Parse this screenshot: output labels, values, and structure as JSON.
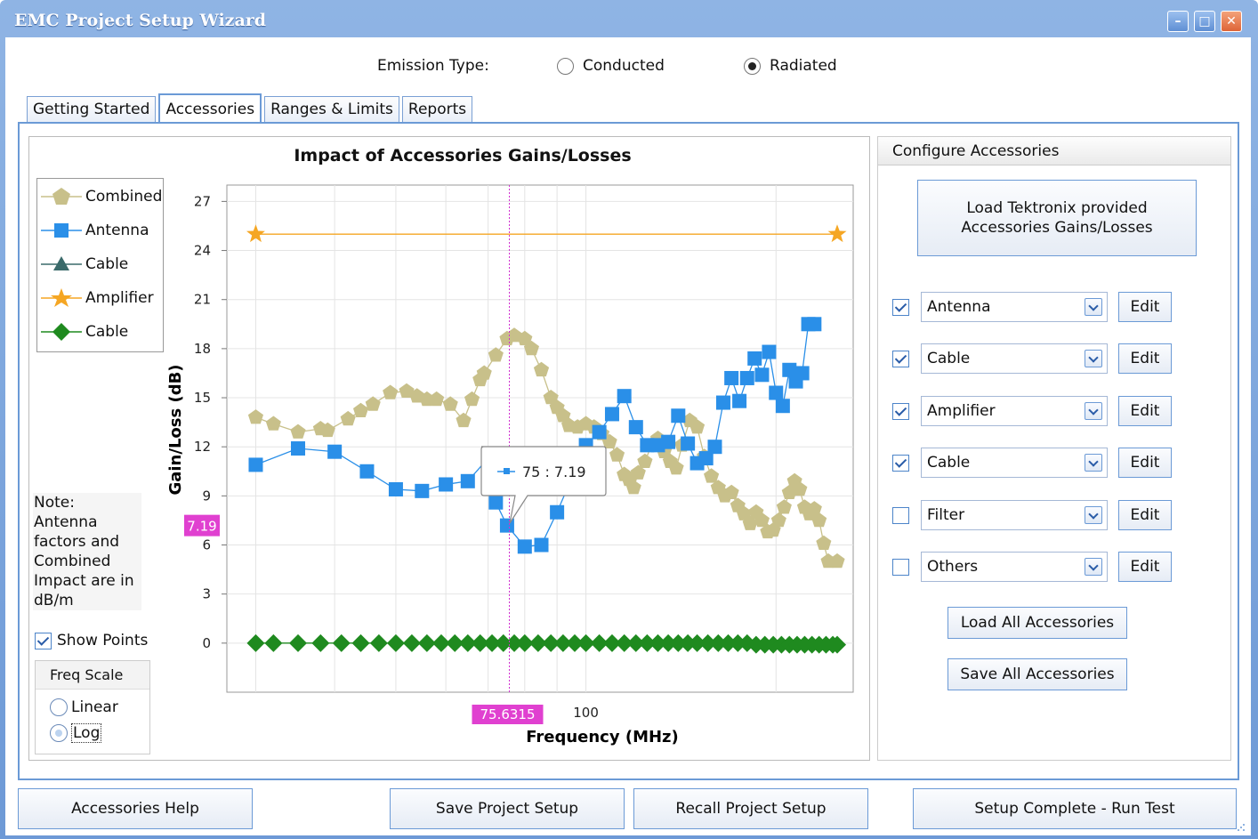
{
  "window": {
    "title": "EMC Project Setup Wizard",
    "controls": [
      "minimize",
      "maximize",
      "close"
    ]
  },
  "emission": {
    "label": "Emission Type:",
    "options": [
      {
        "label": "Conducted",
        "selected": false
      },
      {
        "label": "Radiated",
        "selected": true
      }
    ]
  },
  "tabs": [
    {
      "label": "Getting Started",
      "active": false
    },
    {
      "label": "Accessories",
      "active": true
    },
    {
      "label": "Ranges & Limits",
      "active": false
    },
    {
      "label": "Reports",
      "active": false
    }
  ],
  "chart_data": {
    "type": "line",
    "title": "Impact of Accessories Gains/Losses",
    "xlabel": "Frequency (MHz)",
    "ylabel": "Gain/Loss (dB)",
    "xscale": "log",
    "x_tick_labels": [
      "100"
    ],
    "ylim": [
      -3,
      28
    ],
    "y_ticks": [
      0,
      3,
      6,
      9,
      12,
      15,
      18,
      21,
      24,
      27
    ],
    "grid": true,
    "legend_position": "top-left",
    "series": [
      {
        "name": "Combined",
        "color": "#c8c08a",
        "marker": "pentagon",
        "values": [
          [
            30,
            13.8
          ],
          [
            32,
            13.4
          ],
          [
            35,
            12.9
          ],
          [
            38,
            13.1
          ],
          [
            39,
            13.0
          ],
          [
            42,
            13.7
          ],
          [
            44,
            14.2
          ],
          [
            46,
            14.6
          ],
          [
            49,
            15.3
          ],
          [
            52,
            15.4
          ],
          [
            54,
            15.1
          ],
          [
            56,
            14.9
          ],
          [
            58,
            14.9
          ],
          [
            61,
            14.6
          ],
          [
            64,
            13.6
          ],
          [
            66,
            14.9
          ],
          [
            68,
            16.1
          ],
          [
            69,
            16.5
          ],
          [
            72,
            17.6
          ],
          [
            75,
            18.6
          ],
          [
            77,
            18.8
          ],
          [
            80,
            18.6
          ],
          [
            82,
            18.0
          ],
          [
            85,
            16.7
          ],
          [
            88,
            15.0
          ],
          [
            90,
            14.4
          ],
          [
            92,
            13.9
          ],
          [
            94,
            13.3
          ],
          [
            97,
            13.2
          ],
          [
            100,
            13.4
          ],
          [
            103,
            13.2
          ],
          [
            106,
            12.8
          ],
          [
            109,
            12.3
          ],
          [
            112,
            11.5
          ],
          [
            115,
            10.3
          ],
          [
            117,
            10.0
          ],
          [
            119,
            9.5
          ],
          [
            121,
            10.4
          ],
          [
            124,
            11.1
          ],
          [
            127,
            12.1
          ],
          [
            130,
            12.5
          ],
          [
            133,
            11.7
          ],
          [
            136,
            11.1
          ],
          [
            139,
            10.7
          ],
          [
            142,
            12.1
          ],
          [
            146,
            13.6
          ],
          [
            150,
            13.2
          ],
          [
            154,
            11.4
          ],
          [
            158,
            10.2
          ],
          [
            162,
            9.5
          ],
          [
            166,
            9.0
          ],
          [
            170,
            9.2
          ],
          [
            174,
            8.4
          ],
          [
            178,
            7.9
          ],
          [
            182,
            7.3
          ],
          [
            186,
            8.0
          ],
          [
            190,
            7.5
          ],
          [
            194,
            6.8
          ],
          [
            198,
            6.9
          ],
          [
            202,
            7.5
          ],
          [
            206,
            8.3
          ],
          [
            210,
            9.2
          ],
          [
            214,
            9.9
          ],
          [
            218,
            9.4
          ],
          [
            222,
            8.3
          ],
          [
            226,
            7.9
          ],
          [
            230,
            8.2
          ],
          [
            234,
            7.5
          ],
          [
            238,
            6.1
          ],
          [
            242,
            5.0
          ],
          [
            250,
            5.0
          ]
        ]
      },
      {
        "name": "Antenna",
        "color": "#2a8fe8",
        "marker": "square",
        "values": [
          [
            30,
            10.9
          ],
          [
            35,
            11.9
          ],
          [
            40,
            11.7
          ],
          [
            45,
            10.5
          ],
          [
            50,
            9.4
          ],
          [
            55,
            9.3
          ],
          [
            60,
            9.7
          ],
          [
            65,
            9.9
          ],
          [
            70,
            11.3
          ],
          [
            72,
            8.6
          ],
          [
            75,
            7.19
          ],
          [
            80,
            5.9
          ],
          [
            85,
            6.0
          ],
          [
            90,
            8.0
          ],
          [
            100,
            12.1
          ],
          [
            105,
            12.9
          ],
          [
            110,
            14.0
          ],
          [
            115,
            15.1
          ],
          [
            120,
            13.2
          ],
          [
            125,
            12.1
          ],
          [
            130,
            12.1
          ],
          [
            135,
            12.3
          ],
          [
            140,
            13.9
          ],
          [
            145,
            12.2
          ],
          [
            150,
            11.0
          ],
          [
            155,
            11.3
          ],
          [
            160,
            12.0
          ],
          [
            165,
            14.7
          ],
          [
            170,
            16.2
          ],
          [
            175,
            14.8
          ],
          [
            180,
            16.2
          ],
          [
            185,
            17.4
          ],
          [
            190,
            16.4
          ],
          [
            195,
            17.8
          ],
          [
            200,
            15.3
          ],
          [
            205,
            14.5
          ],
          [
            210,
            16.7
          ],
          [
            215,
            16.0
          ],
          [
            220,
            16.5
          ],
          [
            225,
            19.5
          ],
          [
            230,
            19.5
          ]
        ]
      },
      {
        "name": "Cable",
        "color": "#3a6a6a",
        "marker": "triangle",
        "values": []
      },
      {
        "name": "Amplifier",
        "color": "#f5a623",
        "marker": "star",
        "values": [
          [
            30,
            25
          ],
          [
            250,
            25
          ]
        ]
      },
      {
        "name": "Cable",
        "color": "#1f8a1f",
        "marker": "diamond",
        "values": [
          [
            30,
            0
          ],
          [
            32,
            0
          ],
          [
            35,
            0
          ],
          [
            38,
            0
          ],
          [
            41,
            0
          ],
          [
            44,
            0
          ],
          [
            47,
            0
          ],
          [
            50,
            0
          ],
          [
            53,
            0
          ],
          [
            56,
            0
          ],
          [
            59,
            0
          ],
          [
            62,
            0
          ],
          [
            65,
            0
          ],
          [
            68,
            0
          ],
          [
            71,
            0
          ],
          [
            74,
            0
          ],
          [
            77,
            0
          ],
          [
            80,
            0
          ],
          [
            84,
            0
          ],
          [
            88,
            0
          ],
          [
            92,
            0
          ],
          [
            96,
            0
          ],
          [
            100,
            0
          ],
          [
            105,
            0
          ],
          [
            110,
            0
          ],
          [
            115,
            0
          ],
          [
            120,
            0
          ],
          [
            125,
            0
          ],
          [
            130,
            0
          ],
          [
            135,
            0
          ],
          [
            140,
            0
          ],
          [
            145,
            0
          ],
          [
            150,
            0
          ],
          [
            156,
            0
          ],
          [
            162,
            0
          ],
          [
            168,
            0
          ],
          [
            174,
            0
          ],
          [
            180,
            0
          ],
          [
            186,
            -0.1
          ],
          [
            192,
            -0.1
          ],
          [
            198,
            -0.1
          ],
          [
            204,
            -0.1
          ],
          [
            210,
            -0.1
          ],
          [
            216,
            -0.1
          ],
          [
            222,
            -0.1
          ],
          [
            228,
            -0.1
          ],
          [
            234,
            -0.1
          ],
          [
            240,
            -0.1
          ],
          [
            246,
            -0.1
          ],
          [
            250,
            -0.1
          ]
        ]
      }
    ],
    "cursor": {
      "x_label": "75.6315",
      "y_label": "7.19"
    },
    "tooltip": {
      "text": "75 : 7.19",
      "series": "Antenna"
    }
  },
  "note": {
    "text": "Note: Antenna factors and Combined Impact are in dB/m"
  },
  "show_points": {
    "label": "Show Points",
    "checked": true
  },
  "freq_scale": {
    "label": "Freq Scale",
    "options": [
      {
        "label": "Linear",
        "selected": false
      },
      {
        "label": "Log",
        "selected": true
      }
    ]
  },
  "config": {
    "header": "Configure Accessories",
    "load_tek_line1": "Load Tektronix provided",
    "load_tek_line2": "Accessories Gains/Losses",
    "accessories": [
      {
        "name": "Antenna",
        "checked": true,
        "edit": "Edit"
      },
      {
        "name": "Cable",
        "checked": true,
        "edit": "Edit"
      },
      {
        "name": "Amplifier",
        "checked": true,
        "edit": "Edit"
      },
      {
        "name": "Cable",
        "checked": true,
        "edit": "Edit"
      },
      {
        "name": "Filter",
        "checked": false,
        "edit": "Edit"
      },
      {
        "name": "Others",
        "checked": false,
        "edit": "Edit"
      }
    ],
    "load_all": "Load All Accessories",
    "save_all": "Save All Accessories"
  },
  "footer": {
    "help": "Accessories Help",
    "save": "Save Project Setup",
    "recall": "Recall Project Setup",
    "run": "Setup Complete - Run Test"
  }
}
